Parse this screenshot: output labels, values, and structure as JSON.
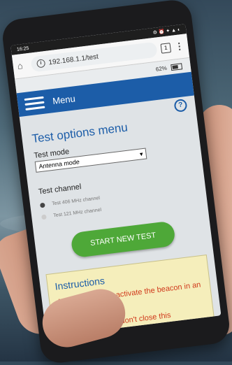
{
  "status_bar": {
    "time": "16:25",
    "icons": "⚙ ⏰ ✦ ▲ ◐"
  },
  "browser": {
    "url": "192.168.1.1/test",
    "tab_count": "1"
  },
  "page": {
    "battery_percent": "62%",
    "menu_label": "Menu",
    "title": "Test options menu",
    "test_mode_label": "Test mode",
    "test_mode_value": "Antenna mode",
    "test_channel_label": "Test channel",
    "channels": [
      {
        "label": "Test 406 MHz channel",
        "selected": true
      },
      {
        "label": "Test 121 MHz channel",
        "selected": false
      }
    ],
    "start_button": "START NEW TEST",
    "instructions_title": "Instructions",
    "instructions_lines": [
      "Attention! Do not activate the beacon in an emergency mode!",
      "Don't refresh and don't close this"
    ]
  },
  "colors": {
    "primary": "#1c5da8",
    "button": "#4ea838",
    "warning": "#d0391b",
    "instructions_bg": "#f5eebb"
  }
}
